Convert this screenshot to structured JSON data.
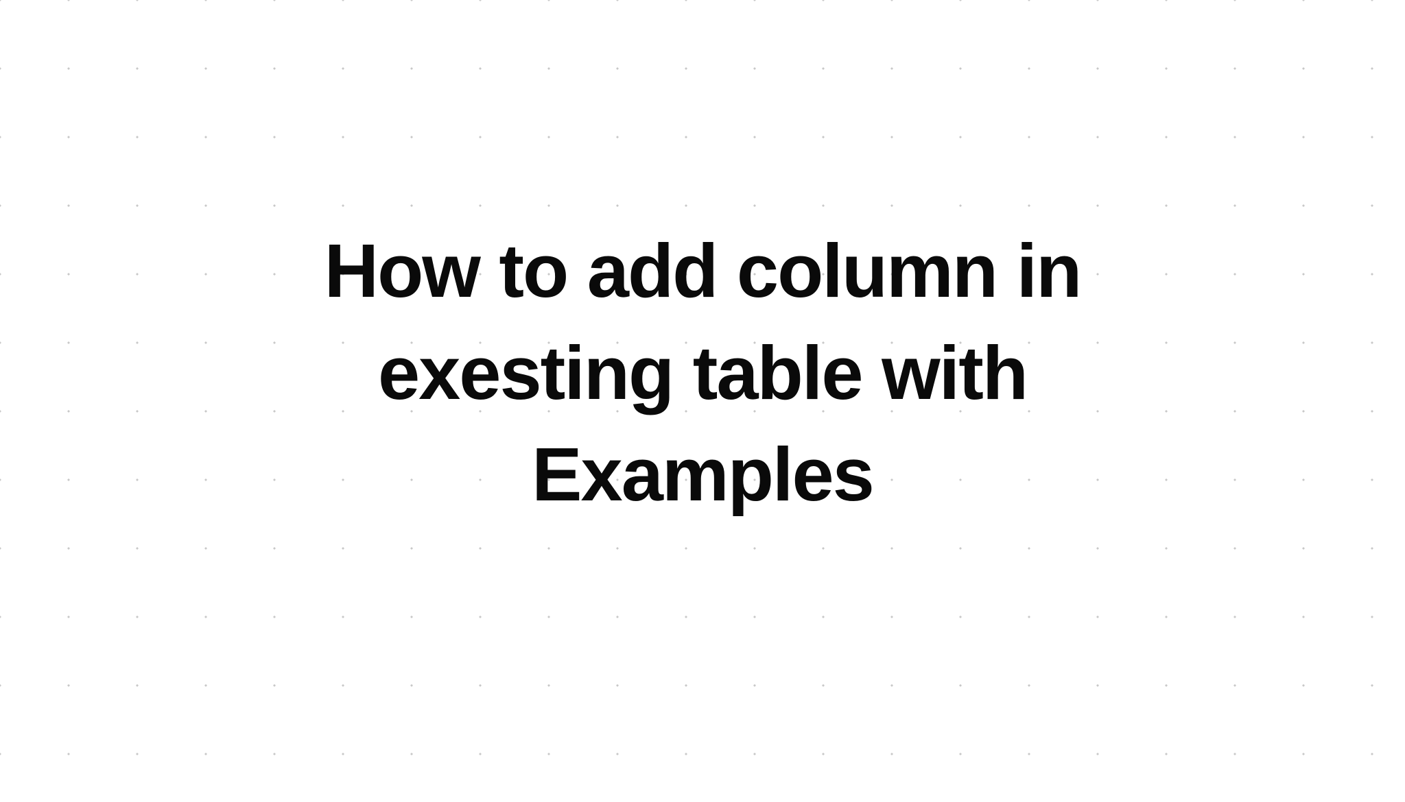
{
  "main": {
    "title": "How to add column in exesting table with Examples"
  }
}
